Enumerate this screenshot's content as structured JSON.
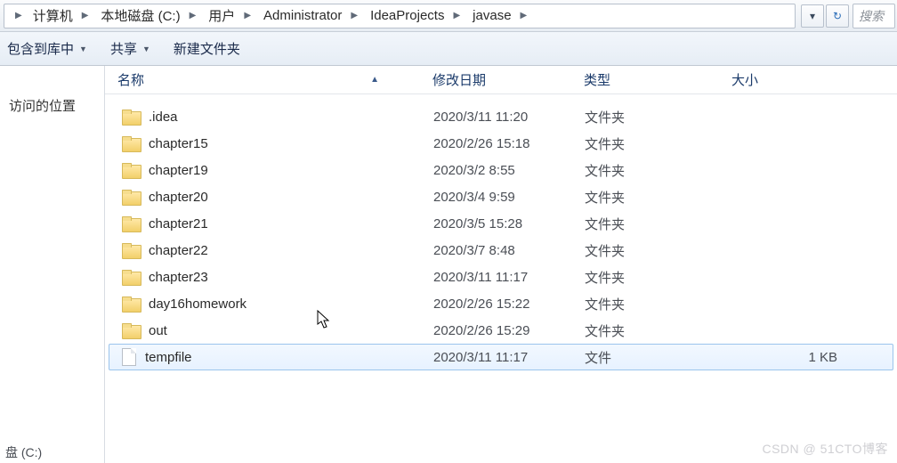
{
  "breadcrumb": {
    "items": [
      {
        "label": "计算机"
      },
      {
        "label": "本地磁盘 (C:)"
      },
      {
        "label": "用户"
      },
      {
        "label": "Administrator"
      },
      {
        "label": "IdeaProjects"
      },
      {
        "label": "javase"
      }
    ]
  },
  "search": {
    "placeholder": "搜索"
  },
  "toolbar": {
    "include_label": "包含到库中",
    "share_label": "共享",
    "new_label": "新建文件夹"
  },
  "navpane": {
    "recent_label": "访问的位置",
    "drive_label": "盘 (C:)"
  },
  "columns": {
    "name": "名称",
    "date": "修改日期",
    "type": "类型",
    "size": "大小"
  },
  "rows": [
    {
      "name": ".idea",
      "date": "2020/3/11 11:20",
      "type": "文件夹",
      "size": "",
      "kind": "folder",
      "selected": false
    },
    {
      "name": "chapter15",
      "date": "2020/2/26 15:18",
      "type": "文件夹",
      "size": "",
      "kind": "folder",
      "selected": false
    },
    {
      "name": "chapter19",
      "date": "2020/3/2 8:55",
      "type": "文件夹",
      "size": "",
      "kind": "folder",
      "selected": false
    },
    {
      "name": "chapter20",
      "date": "2020/3/4 9:59",
      "type": "文件夹",
      "size": "",
      "kind": "folder",
      "selected": false
    },
    {
      "name": "chapter21",
      "date": "2020/3/5 15:28",
      "type": "文件夹",
      "size": "",
      "kind": "folder",
      "selected": false
    },
    {
      "name": "chapter22",
      "date": "2020/3/7 8:48",
      "type": "文件夹",
      "size": "",
      "kind": "folder",
      "selected": false
    },
    {
      "name": "chapter23",
      "date": "2020/3/11 11:17",
      "type": "文件夹",
      "size": "",
      "kind": "folder",
      "selected": false
    },
    {
      "name": "day16homework",
      "date": "2020/2/26 15:22",
      "type": "文件夹",
      "size": "",
      "kind": "folder",
      "selected": false
    },
    {
      "name": "out",
      "date": "2020/2/26 15:29",
      "type": "文件夹",
      "size": "",
      "kind": "folder",
      "selected": false
    },
    {
      "name": "tempfile",
      "date": "2020/3/11 11:17",
      "type": "文件",
      "size": "1 KB",
      "kind": "file",
      "selected": true
    }
  ],
  "watermark": "CSDN @ 51CTO博客",
  "bottomleft": "盘 (C:)"
}
